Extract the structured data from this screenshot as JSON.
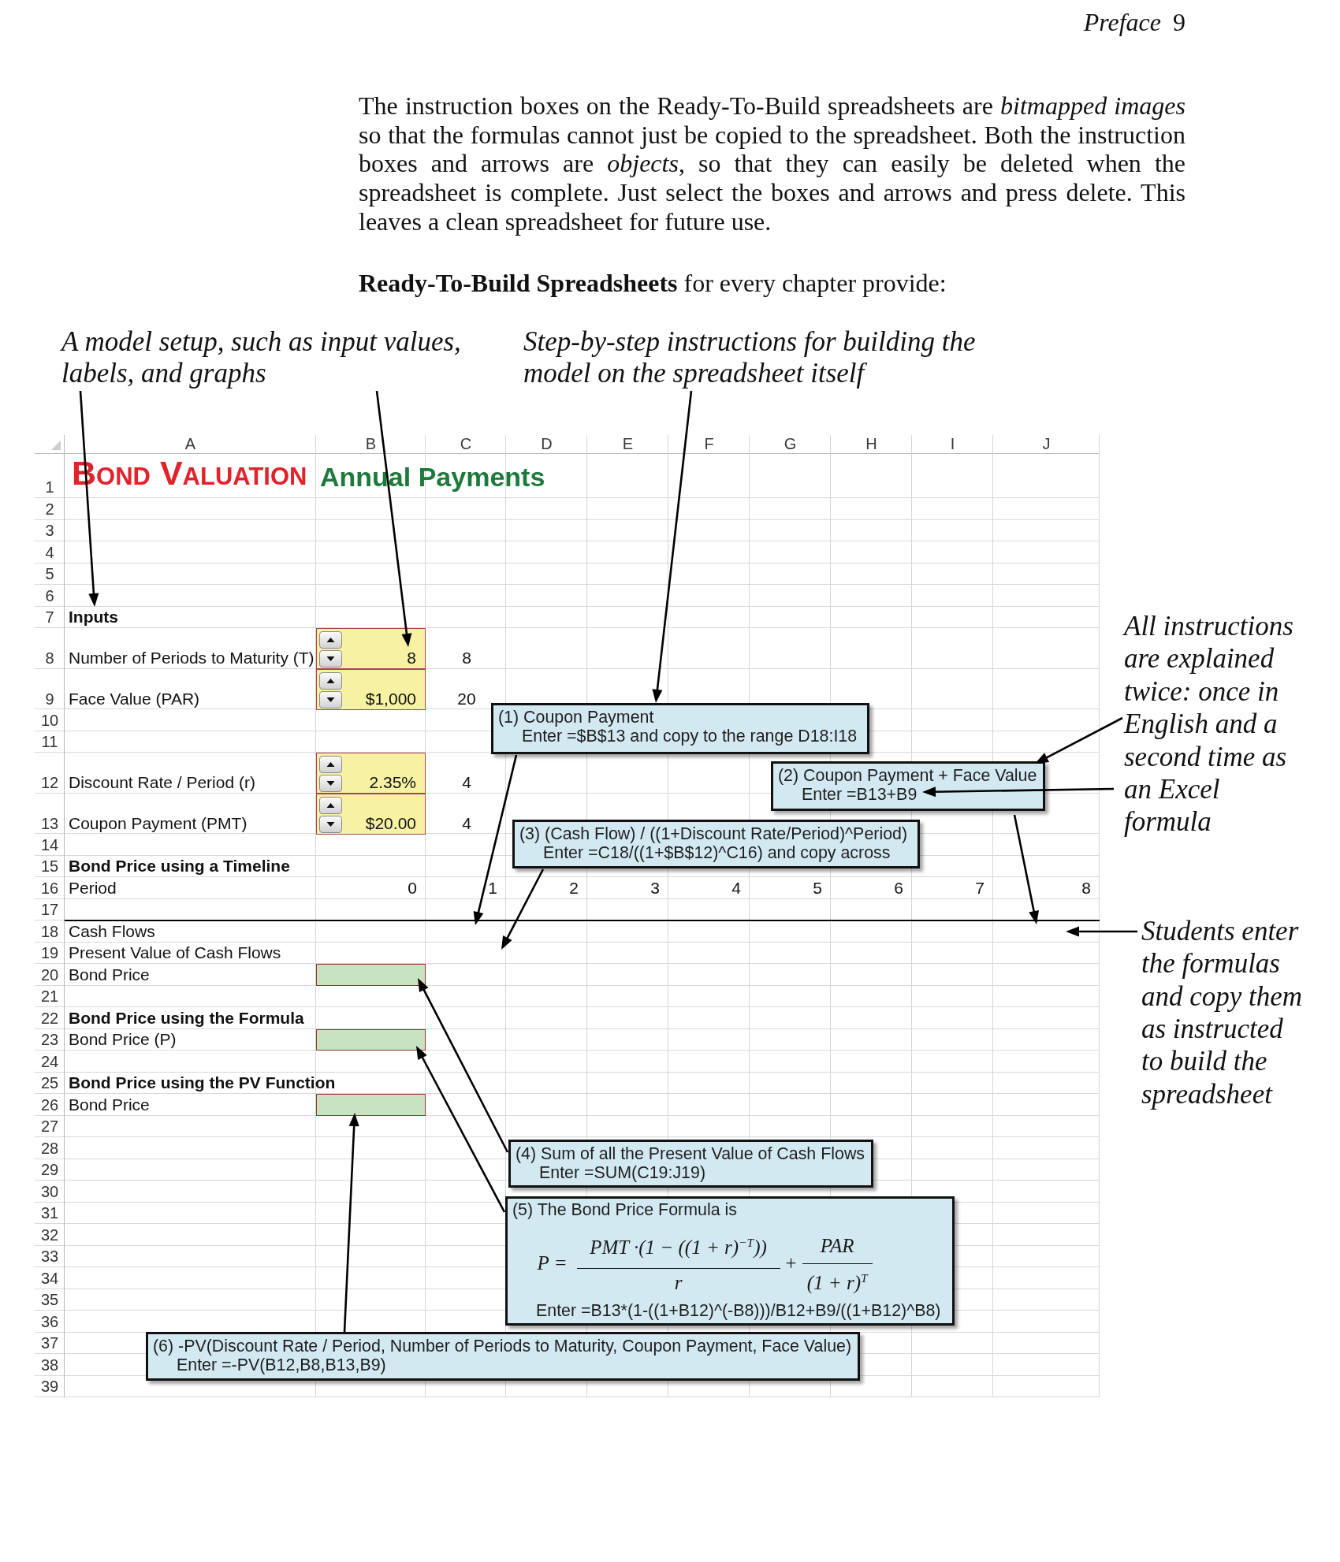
{
  "page_header": {
    "section": "Preface",
    "page": "9"
  },
  "intro": {
    "paragraph": "The instruction boxes on the Ready-To-Build spreadsheets are *bitmapped images* so that the formulas cannot just be copied to the spreadsheet. Both the instruction boxes and arrows are *objects*, so that they can easily be deleted when the spreadsheet is complete. Just select the boxes and arrows and press delete. This leaves a clean spreadsheet for future use.",
    "lead": "**Ready-To-Build Spreadsheets** for every chapter provide:"
  },
  "annotations": [
    {
      "text": "A model setup, such as input values, labels, and graphs"
    },
    {
      "text": "Step-by-step instructions for building the model on the spreadsheet itself"
    }
  ],
  "sheet": {
    "columns": [
      "A",
      "B",
      "C",
      "D",
      "E",
      "F",
      "G",
      "H",
      "I",
      "J"
    ],
    "rows": [
      {
        "number": "1",
        "rule_below": false,
        "cells": [
          {
            "kind": "title",
            "text": "BOND VALUATION"
          },
          {
            "kind": "subtitle",
            "text": "Annual Payments"
          }
        ]
      },
      {
        "number": "2",
        "rule_below": false
      },
      {
        "number": "3",
        "rule_below": false
      },
      {
        "number": "4",
        "rule_below": false
      },
      {
        "number": "5",
        "rule_below": false
      },
      {
        "number": "6",
        "rule_below": false
      },
      {
        "number": "7",
        "rule_below": false,
        "cells": [
          {
            "kind": "heading",
            "text": "Inputs"
          }
        ]
      },
      {
        "number": "8",
        "rule_below": false,
        "cells": [
          {
            "kind": "label",
            "text": "Number of Periods to Maturity (T)"
          },
          {
            "kind": "input",
            "value": "8"
          },
          {
            "kind": "linked",
            "text": "8"
          }
        ]
      },
      {
        "number": "9",
        "rule_below": false,
        "cells": [
          {
            "kind": "label",
            "text": "Face Value (PAR)"
          },
          {
            "kind": "input",
            "value": "$1,000"
          },
          {
            "kind": "linked",
            "text": "20"
          }
        ]
      },
      {
        "number": "10",
        "rule_below": false
      },
      {
        "number": "11",
        "rule_below": false
      },
      {
        "number": "12",
        "rule_below": false,
        "cells": [
          {
            "kind": "label",
            "text": "Discount Rate / Period (r)"
          },
          {
            "kind": "input",
            "value": "2.35%"
          },
          {
            "kind": "linked",
            "text": "4"
          }
        ]
      },
      {
        "number": "13",
        "rule_below": false,
        "cells": [
          {
            "kind": "label",
            "text": "Coupon Payment (PMT)"
          },
          {
            "kind": "input",
            "value": "$20.00"
          },
          {
            "kind": "linked",
            "text": "4"
          }
        ]
      },
      {
        "number": "14",
        "rule_below": false
      },
      {
        "number": "15",
        "rule_below": false,
        "cells": [
          {
            "kind": "heading",
            "text": "Bond Price using a Timeline"
          }
        ]
      },
      {
        "number": "16",
        "rule_below": false,
        "cells": [
          {
            "kind": "label",
            "text": "Period"
          },
          {
            "kind": "number",
            "text": "0"
          },
          {
            "kind": "number",
            "text": "1"
          },
          {
            "kind": "number",
            "text": "2"
          },
          {
            "kind": "number",
            "text": "3"
          },
          {
            "kind": "number",
            "text": "4"
          },
          {
            "kind": "number",
            "text": "5"
          },
          {
            "kind": "number",
            "text": "6"
          },
          {
            "kind": "number",
            "text": "7"
          },
          {
            "kind": "number",
            "text": "8"
          }
        ]
      },
      {
        "number": "17",
        "rule_below": true
      },
      {
        "number": "18",
        "rule_below": false,
        "cells": [
          {
            "kind": "label",
            "text": "Cash Flows"
          }
        ]
      },
      {
        "number": "19",
        "rule_below": false,
        "cells": [
          {
            "kind": "label",
            "text": "Present Value of Cash Flows"
          }
        ]
      },
      {
        "number": "20",
        "rule_below": false,
        "cells": [
          {
            "kind": "label",
            "text": "Bond Price"
          },
          {
            "kind": "output"
          }
        ]
      },
      {
        "number": "21",
        "rule_below": false
      },
      {
        "number": "22",
        "rule_below": false,
        "cells": [
          {
            "kind": "heading",
            "text": "Bond Price using the Formula"
          }
        ]
      },
      {
        "number": "23",
        "rule_below": false,
        "cells": [
          {
            "kind": "label",
            "text": "Bond Price (P)"
          },
          {
            "kind": "output"
          }
        ]
      },
      {
        "number": "24",
        "rule_below": false
      },
      {
        "number": "25",
        "rule_below": false,
        "cells": [
          {
            "kind": "heading",
            "text": "Bond Price using the PV Function"
          }
        ]
      },
      {
        "number": "26",
        "rule_below": false,
        "cells": [
          {
            "kind": "label",
            "text": "Bond Price"
          },
          {
            "kind": "output"
          }
        ]
      },
      {
        "number": "27",
        "rule_below": false
      },
      {
        "number": "28",
        "rule_below": false
      },
      {
        "number": "29",
        "rule_below": false
      },
      {
        "number": "30",
        "rule_below": false
      },
      {
        "number": "31",
        "rule_below": false
      },
      {
        "number": "32",
        "rule_below": false
      },
      {
        "number": "33",
        "rule_below": false
      },
      {
        "number": "34",
        "rule_below": false
      },
      {
        "number": "35",
        "rule_below": false
      },
      {
        "number": "36",
        "rule_below": false
      },
      {
        "number": "37",
        "rule_below": false
      },
      {
        "number": "38",
        "rule_below": false
      },
      {
        "number": "39",
        "rule_below": false
      }
    ]
  },
  "side_notes": [
    {
      "text": "All instructions are explained twice: once in English and a second time as an Excel formula"
    },
    {
      "text": "Students enter the formulas and copy them as instructed to build the spreadsheet"
    }
  ],
  "callouts": [
    {
      "kind": "instruction",
      "title": "(1) Coupon Payment",
      "entry": "Enter =$B$13 and copy to the range D18:I18"
    },
    {
      "kind": "instruction",
      "title": "(2) Coupon Payment + Face Value",
      "entry": "Enter =B13+B9"
    },
    {
      "kind": "instruction",
      "title": "(3) (Cash Flow) / ((1+Discount Rate/Period)^Period)",
      "entry": "Enter =C18/((1+$B$12)^C16) and copy across"
    },
    {
      "kind": "instruction",
      "title": "(4) Sum of all the Present Value of Cash Flows",
      "entry": "Enter =SUM(C19:J19)"
    },
    {
      "kind": "formula",
      "title": "(5) The Bond Price Formula is",
      "equation": {
        "lhs": "P =",
        "fraction_1": {
          "numerator": "PMT ·(1 − ((1 + r)$^{−T}$))",
          "denominator": "r"
        },
        "operator": "+",
        "fraction_2": {
          "numerator": "PAR",
          "denominator": "(1 + r)$^{T}$"
        }
      },
      "entry": "Enter =B13*(1-((1+B12)^(-B8)))/B12+B9/((1+B12)^B8)"
    },
    {
      "kind": "instruction",
      "title": "(6) -PV(Discount Rate / Period, Number of Periods to Maturity, Coupon Payment, Face Value)",
      "entry": "Enter =-PV(B12,B8,B13,B9)"
    }
  ]
}
